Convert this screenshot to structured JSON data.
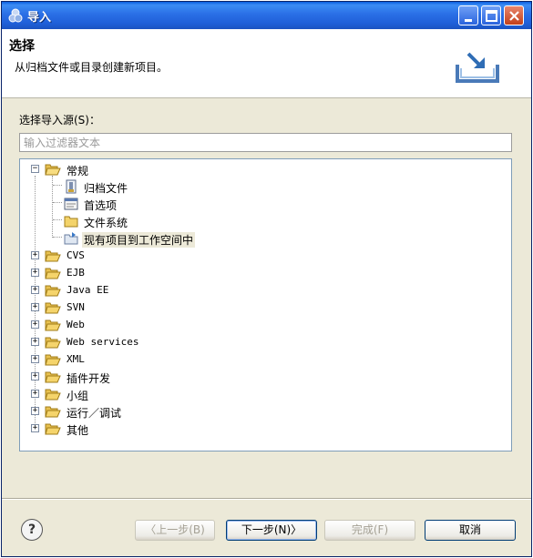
{
  "window": {
    "title": "导入"
  },
  "header": {
    "title": "选择",
    "description": "从归档文件或目录创建新项目。"
  },
  "source": {
    "label": "选择导入源(S)：",
    "filter_placeholder": "输入过滤器文本",
    "filter_value": ""
  },
  "tree": {
    "general": {
      "label": "常规",
      "expander": "−",
      "children": [
        "归档文件",
        "首选项",
        "文件系统",
        "现有项目到工作空间中"
      ]
    },
    "categories": [
      "CVS",
      "EJB",
      "Java EE",
      "SVN",
      "Web",
      "Web services",
      "XML",
      "插件开发",
      "小组",
      "运行／调试",
      "其他"
    ],
    "expander": "+"
  },
  "buttons": {
    "help": "?",
    "back": "〈上一步(B)",
    "next": "下一步(N)〉",
    "finish": "完成(F)",
    "cancel": "取消"
  },
  "colors": {
    "titlebar": "#2a6fe6",
    "dialog_bg": "#ece9d8",
    "folder": "#f5d46b"
  }
}
